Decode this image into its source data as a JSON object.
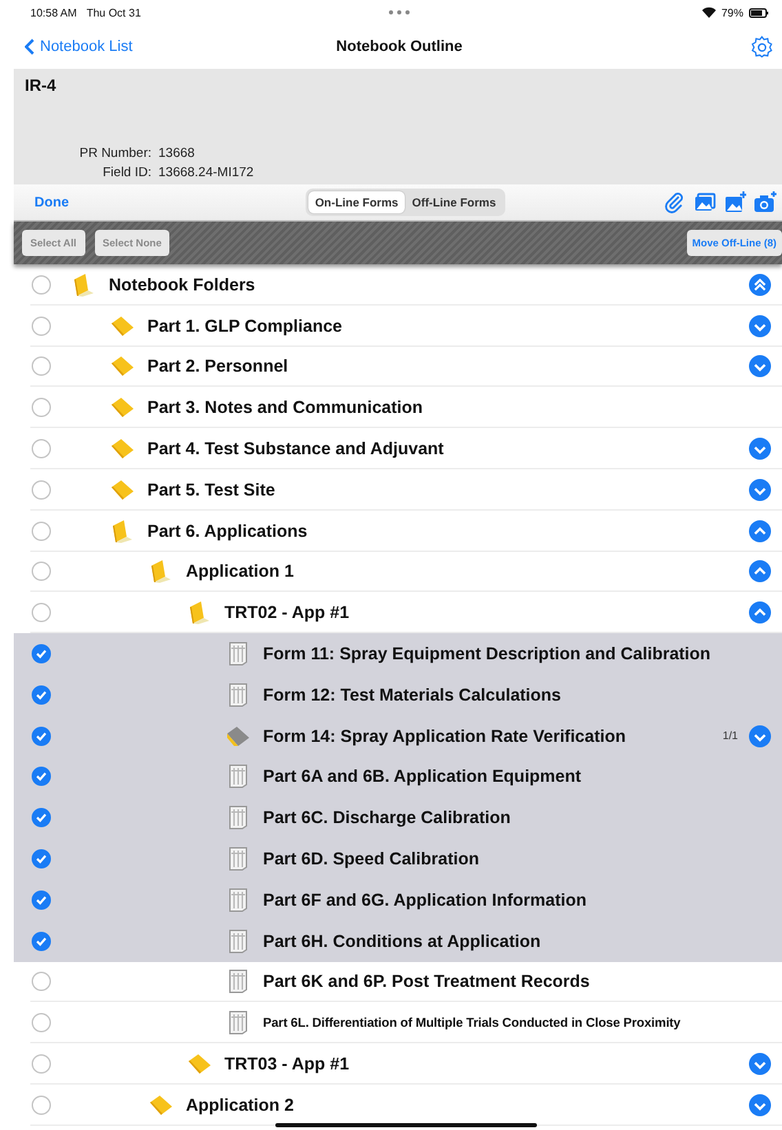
{
  "status_bar": {
    "time": "10:58 AM",
    "date": "Thu Oct 31",
    "battery": "79%"
  },
  "nav": {
    "back": "Notebook List",
    "title": "Notebook Outline"
  },
  "header": {
    "title": "IR-4",
    "fields": [
      {
        "label": "PR Number:",
        "value": "13668"
      },
      {
        "label": "Field ID:",
        "value": "13668.24-MI172"
      }
    ]
  },
  "toolbar": {
    "done": "Done",
    "segments": [
      {
        "label": "On-Line Forms",
        "selected": true
      },
      {
        "label": "Off-Line Forms",
        "selected": false
      }
    ]
  },
  "selection_bar": {
    "select_all": "Select All",
    "select_none": "Select None",
    "move": "Move Off-Line (8)"
  },
  "outline": [
    {
      "label": "Notebook Folders",
      "checked": false,
      "kind": "folder",
      "expanded": true,
      "children": [
        {
          "label": "Part 1. GLP Compliance",
          "checked": false,
          "kind": "folder",
          "expanded": false
        },
        {
          "label": "Part 2. Personnel",
          "checked": false,
          "kind": "folder",
          "expanded": false
        },
        {
          "label": "Part 3. Notes and Communication",
          "checked": false,
          "kind": "folder",
          "expanded": false,
          "empty": true
        },
        {
          "label": "Part 4. Test Substance and Adjuvant",
          "checked": false,
          "kind": "folder",
          "expanded": false
        },
        {
          "label": "Part 5. Test Site",
          "checked": false,
          "kind": "folder",
          "expanded": false
        },
        {
          "label": "Part 6. Applications",
          "checked": false,
          "kind": "folder",
          "expanded": true,
          "children": [
            {
              "label": "Application 1",
              "checked": false,
              "kind": "folder",
              "expanded": true,
              "children": [
                {
                  "label": "TRT02 - App #1",
                  "checked": false,
                  "kind": "folder",
                  "expanded": true,
                  "children": [
                    {
                      "label": "Form 11: Spray Equipment Description and Calibration",
                      "checked": true,
                      "kind": "form"
                    },
                    {
                      "label": "Form 12: Test Materials Calculations",
                      "checked": true,
                      "kind": "form"
                    },
                    {
                      "label": "Form 14: Spray Application Rate Verification",
                      "checked": true,
                      "kind": "filled",
                      "expanded": false,
                      "count": "1/1"
                    },
                    {
                      "label": "Part 6A and 6B. Application Equipment",
                      "checked": true,
                      "kind": "form"
                    },
                    {
                      "label": "Part 6C. Discharge Calibration",
                      "checked": true,
                      "kind": "form"
                    },
                    {
                      "label": "Part 6D. Speed Calibration",
                      "checked": true,
                      "kind": "form"
                    },
                    {
                      "label": "Part 6F and 6G. Application Information",
                      "checked": true,
                      "kind": "form"
                    },
                    {
                      "label": "Part 6H.  Conditions at Application",
                      "checked": true,
                      "kind": "form"
                    },
                    {
                      "label": "Part 6K and 6P. Post Treatment Records",
                      "checked": false,
                      "kind": "form"
                    },
                    {
                      "label": "Part 6L. Differentiation of Multiple Trials Conducted in Close Proximity",
                      "checked": false,
                      "kind": "form",
                      "compact": true
                    }
                  ]
                },
                {
                  "label": "TRT03 - App #1",
                  "checked": false,
                  "kind": "folder",
                  "expanded": false
                }
              ]
            },
            {
              "label": "Application 2",
              "checked": false,
              "kind": "folder",
              "expanded": false
            }
          ]
        }
      ]
    }
  ]
}
